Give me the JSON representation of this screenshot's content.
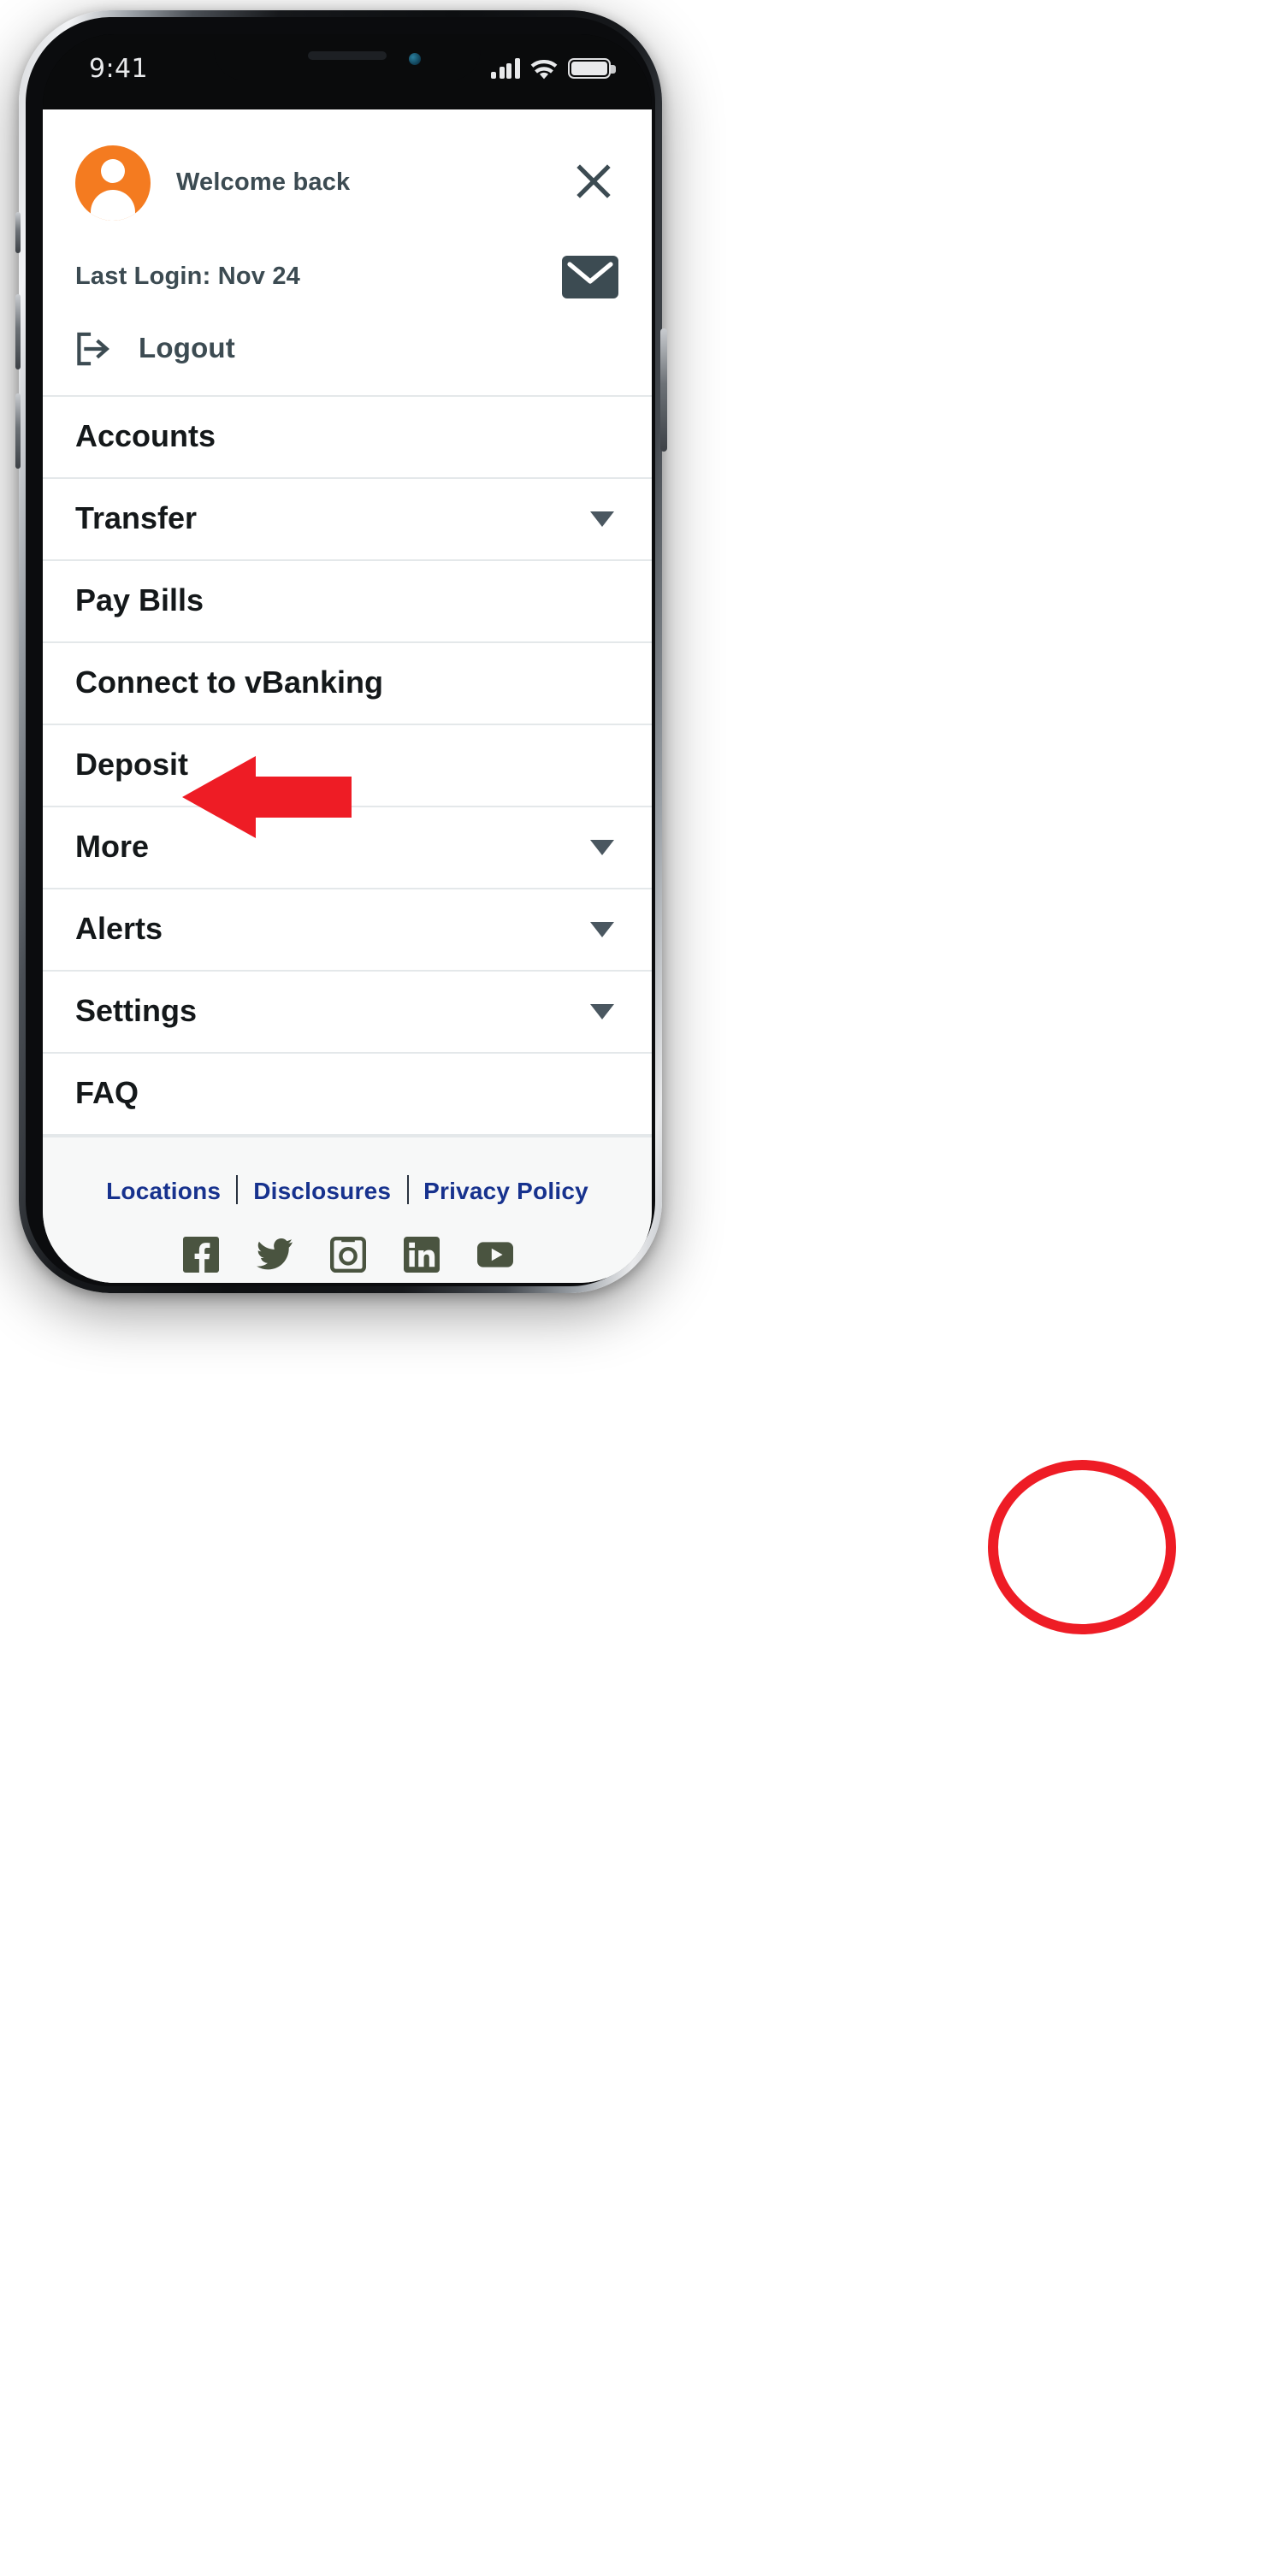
{
  "status_bar": {
    "time": "9:41",
    "icons": [
      "signal-bars-icon",
      "wifi-icon",
      "battery-icon"
    ]
  },
  "header": {
    "avatar_icon": "user-avatar-icon",
    "avatar_color": "#F47B20",
    "welcome_text": "Welcome back",
    "close_label": "×",
    "close_icon": "close-x-icon",
    "last_login": "Last Login: Nov 24",
    "mail_icon": "envelope-icon",
    "logout_icon": "logout-arrow-icon",
    "logout_label": "Logout"
  },
  "menu": {
    "items": [
      {
        "label": "Accounts",
        "has_chevron": false
      },
      {
        "label": "Transfer",
        "has_chevron": true
      },
      {
        "label": "Pay Bills",
        "has_chevron": false
      },
      {
        "label": "Connect to vBanking",
        "has_chevron": false
      },
      {
        "label": "Deposit",
        "has_chevron": false
      },
      {
        "label": "More",
        "has_chevron": true
      },
      {
        "label": "Alerts",
        "has_chevron": true
      },
      {
        "label": "Settings",
        "has_chevron": true
      },
      {
        "label": "FAQ",
        "has_chevron": false
      }
    ],
    "chevron_icon": "chevron-down-icon",
    "chevron_color": "#4a5760"
  },
  "footer": {
    "links": [
      "Locations",
      "Disclosures",
      "Privacy Policy"
    ],
    "link_color": "#17328e",
    "socials": [
      {
        "name": "facebook-icon"
      },
      {
        "name": "twitter-icon"
      },
      {
        "name": "instagram-icon"
      },
      {
        "name": "linkedin-icon"
      },
      {
        "name": "youtube-icon"
      }
    ],
    "social_color": "#4a5440"
  },
  "annotations": {
    "color": "#ee1c25",
    "arrow_target": "More",
    "circle_target": "More chevron-down-icon"
  }
}
